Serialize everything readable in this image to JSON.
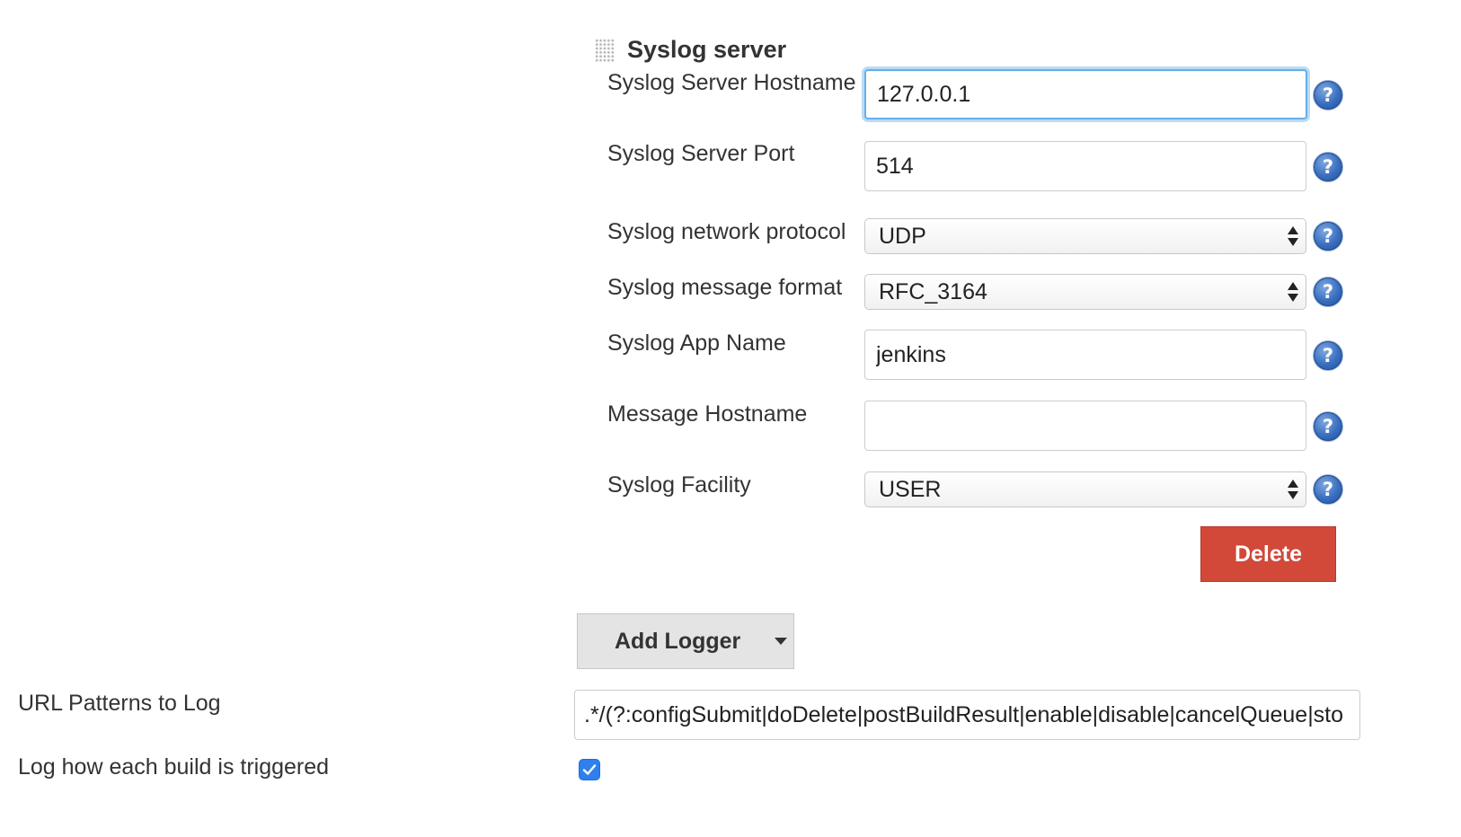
{
  "syslog_server": {
    "title": "Syslog server",
    "fields": {
      "hostname": {
        "label": "Syslog Server Hostname",
        "value": "127.0.0.1"
      },
      "port": {
        "label": "Syslog Server Port",
        "value": "514"
      },
      "protocol": {
        "label": "Syslog network protocol",
        "selected": "UDP"
      },
      "format": {
        "label": "Syslog message format",
        "selected": "RFC_3164"
      },
      "app_name": {
        "label": "Syslog App Name",
        "value": "jenkins"
      },
      "message_hostname": {
        "label": "Message Hostname",
        "value": ""
      },
      "facility": {
        "label": "Syslog Facility",
        "selected": "USER"
      }
    },
    "help_icon_glyph": "?",
    "delete_label": "Delete"
  },
  "add_logger": {
    "label": "Add Logger"
  },
  "url_patterns": {
    "label": "URL Patterns to Log",
    "value": ".*/(?:configSubmit|doDelete|postBuildResult|enable|disable|cancelQueue|sto"
  },
  "log_build_trigger": {
    "label": "Log how each build is triggered",
    "checked": true
  },
  "colors": {
    "delete_button": "#d24939",
    "focus_ring": "#66afe9",
    "checkbox": "#2f80ed",
    "help_icon": "#3a6fc0"
  },
  "icons": {
    "drag_handle": "drag-handle-icon",
    "help": "help-icon",
    "select_arrows": "updown-arrows-icon",
    "dropdown_caret": "chevron-down-icon",
    "check": "checkmark-icon"
  }
}
